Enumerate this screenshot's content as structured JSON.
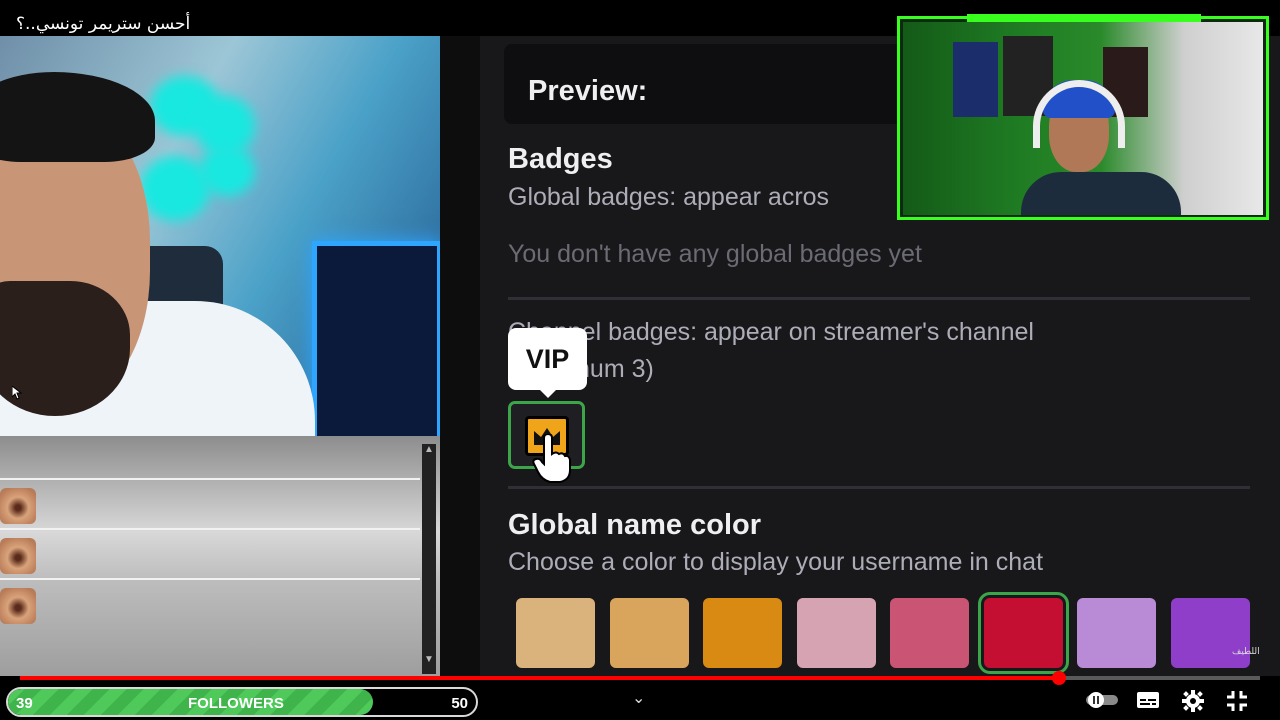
{
  "video": {
    "title": "أحسن ستريمر تونسي..؟",
    "watermark": "اللطيف"
  },
  "settings": {
    "preview_label": "Preview:",
    "badges": {
      "heading": "Badges",
      "global_desc": "Global badges: appear acros",
      "global_empty": "You don't have any global badges yet",
      "channel_desc_line1": "Channel badges: appear on streamer's channel",
      "channel_desc_line2": "(maximum 3)",
      "tooltip": "VIP",
      "selected_badge_icon": "crown-icon"
    },
    "name_color": {
      "heading": "Global name color",
      "desc": "Choose a color to display your username in chat",
      "swatches": [
        {
          "color": "#d9b27c",
          "selected": false
        },
        {
          "color": "#d9a55c",
          "selected": false
        },
        {
          "color": "#d88a12",
          "selected": false
        },
        {
          "color": "#d6a3b3",
          "selected": false
        },
        {
          "color": "#c95474",
          "selected": false
        },
        {
          "color": "#c40e32",
          "selected": true
        },
        {
          "color": "#b98ad6",
          "selected": false
        },
        {
          "color": "#8e3ec9",
          "selected": false
        }
      ]
    }
  },
  "followers_goal": {
    "current": "39",
    "label": "FOLLOWERS",
    "goal": "50",
    "progress": 0.78,
    "accent": "#4ec95a"
  },
  "player": {
    "progress": 0.838,
    "accent": "#ff0000",
    "icons": [
      "chevron-down-icon",
      "autoplay-toggle-icon",
      "subtitles-icon",
      "settings-gear-icon",
      "exit-fullscreen-icon"
    ]
  },
  "colors": {
    "panel_bg": "#18181b",
    "facecam_frame": "#39ff1f"
  }
}
